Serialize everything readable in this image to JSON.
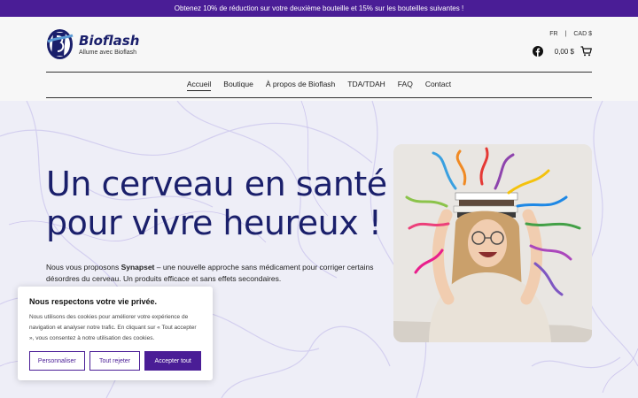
{
  "promo": {
    "text": "Obtenez 10% de réduction sur votre deuxième bouteille et 15% sur les bouteilles suivantes !"
  },
  "header": {
    "logo_name": "Bioflash",
    "logo_tagline": "Allume avec Bioflash",
    "lang": "FR",
    "separator": "|",
    "currency": "CAD $",
    "cart_total": "0,00 $"
  },
  "nav": {
    "items": [
      {
        "label": "Accueil"
      },
      {
        "label": "Boutique"
      },
      {
        "label": "À propos de Bioflash"
      },
      {
        "label": "TDA/TDAH"
      },
      {
        "label": "FAQ"
      },
      {
        "label": "Contact"
      }
    ]
  },
  "hero": {
    "headline": "Un cerveau en santé pour vivre heureux !",
    "intro_pre": "Nous vous proposons ",
    "intro_product": "Synapset",
    "intro_post": " – une nouvelle approche sans médicament pour corriger certains désordres du cerveau. Un produits efficace et sans effets secondaires."
  },
  "cookie": {
    "title": "Nous respectons votre vie privée.",
    "text": "Nous utilisons des cookies pour améliorer votre expérience de navigation et analyser notre trafic. En cliquant sur « Tout accepter », vous consentez à notre utilisation des cookies.",
    "customize": "Personnaliser",
    "reject": "Tout rejeter",
    "accept": "Accepter tout"
  },
  "colors": {
    "brand": "#4a1d96",
    "headline": "#1a1f6b"
  },
  "icons": [
    "facebook-icon",
    "cart-icon",
    "logo-icon"
  ]
}
